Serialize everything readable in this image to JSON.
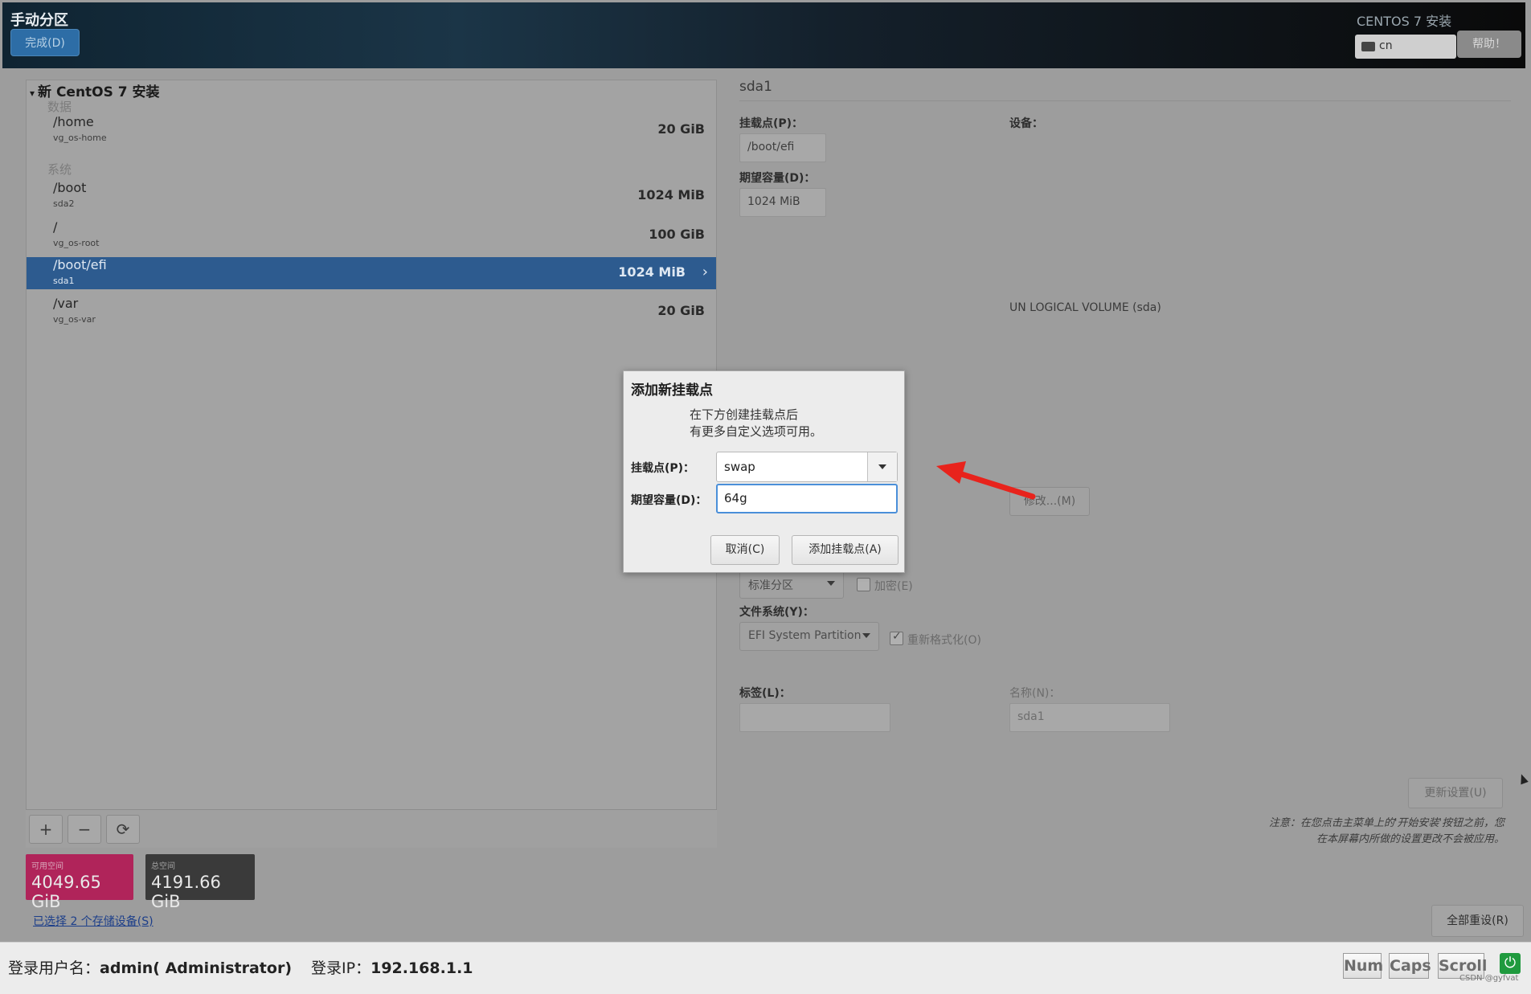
{
  "header": {
    "title": "手动分区",
    "done_label": "完成(D)",
    "installer_name": "CENTOS 7 安装",
    "keyboard_layout": "cn",
    "help_label": "帮助！"
  },
  "tree": {
    "root_label": "新 CentOS 7 安装",
    "groups": [
      {
        "label": "数据"
      },
      {
        "label": "系统"
      }
    ],
    "rows": [
      {
        "mount": "/home",
        "device": "vg_os-home",
        "size": "20 GiB"
      },
      {
        "mount": "/boot",
        "device": "sda2",
        "size": "1024 MiB"
      },
      {
        "mount": "/",
        "device": "vg_os-root",
        "size": "100 GiB"
      },
      {
        "mount": "/boot/efi",
        "device": "sda1",
        "size": "1024 MiB",
        "selected": true
      },
      {
        "mount": "/var",
        "device": "vg_os-var",
        "size": "20 GiB"
      }
    ]
  },
  "toolbar": {
    "add": "+",
    "remove": "−",
    "refresh": "⟳"
  },
  "space": {
    "available_label": "可用空间",
    "available_value": "4049.65 GiB",
    "total_label": "总空间",
    "total_value": "4191.66 GiB"
  },
  "storage_link": "已选择 2 个存储设备(S)",
  "detail": {
    "device_title": "sda1",
    "mount_label": "挂载点(P)：",
    "mount_value": "/boot/efi",
    "capacity_label": "期望容量(D)：",
    "capacity_value": "1024 MiB",
    "device_label": "设备：",
    "lvm_text": "UN LOGICAL VOLUME (sda)",
    "modify_label": "修改...(M)",
    "device_type_value": "标准分区",
    "encrypt_label": "加密(E)",
    "fs_label": "文件系统(Y)：",
    "fs_value": "EFI System Partition",
    "reformat_label": "重新格式化(O)",
    "tag_label": "标签(L)：",
    "tag_value": "",
    "name_label": "名称(N)：",
    "name_value": "sda1",
    "update_label": "更新设置(U)",
    "note_line1": "注意：在您点击主菜单上的'开始安装'按钮之前，您",
    "note_line2": "在本屏幕内所做的设置更改不会被应用。",
    "reset_label": "全部重设(R)"
  },
  "modal": {
    "title": "添加新挂载点",
    "desc_line1": "在下方创建挂载点后",
    "desc_line2": "有更多自定义选项可用。",
    "mount_label": "挂载点(P)：",
    "mount_value": "swap",
    "capacity_label": "期望容量(D)：",
    "capacity_value": "64g",
    "cancel_label": "取消(C)",
    "add_label": "添加挂载点(A)"
  },
  "status": {
    "user_label": "登录用户名：",
    "user_value": "admin( Administrator)",
    "ip_label": "登录IP：",
    "ip_value": "192.168.1.1",
    "num": "Num",
    "caps": "Caps",
    "scroll": "Scroll",
    "watermark": "CSDN @gyfvat"
  },
  "colors": {
    "accent": "#2d5b8f",
    "available": "#b0245a",
    "arrow": "#e8231c"
  }
}
